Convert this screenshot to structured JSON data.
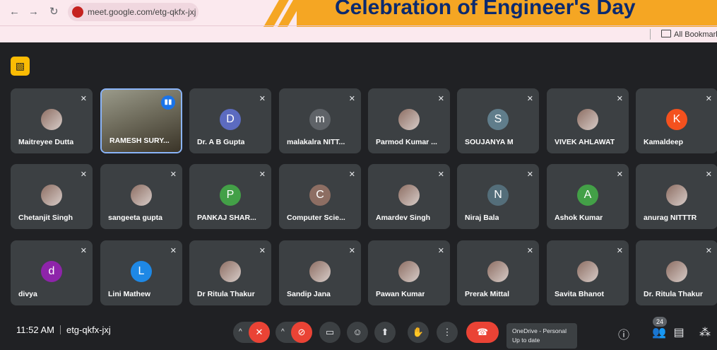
{
  "browser": {
    "back_icon": "arrow-left-icon",
    "forward_icon": "arrow-right-icon",
    "reload_icon": "reload-icon",
    "url": "meet.google.com/etg-qkfx-jxj",
    "banner_title": "Celebration of Engineer's Day",
    "bookmarks_label": "All Bookmarks"
  },
  "meet": {
    "participants": [
      {
        "name": "Maitreyee Dutta",
        "type": "photo"
      },
      {
        "name": "RAMESH SURY...",
        "type": "video",
        "speaking": true
      },
      {
        "name": "Dr. A B Gupta",
        "type": "initial",
        "initial": "D",
        "color": "#5c6bc0"
      },
      {
        "name": "malakalra NITT...",
        "type": "initial",
        "initial": "m",
        "color": "#5f6368"
      },
      {
        "name": "Parmod Kumar ...",
        "type": "photo"
      },
      {
        "name": "SOUJANYA M",
        "type": "initial",
        "initial": "S",
        "color": "#607d8b"
      },
      {
        "name": "VIVEK AHLAWAT",
        "type": "photo"
      },
      {
        "name": "Kamaldeep",
        "type": "initial",
        "initial": "K",
        "color": "#f4511e"
      },
      {
        "name": "Chetanjit Singh",
        "type": "photo"
      },
      {
        "name": "sangeeta gupta",
        "type": "photo"
      },
      {
        "name": "PANKAJ SHAR...",
        "type": "initial",
        "initial": "P",
        "color": "#43a047"
      },
      {
        "name": "Computer Scie...",
        "type": "initial",
        "initial": "C",
        "color": "#8d6e63"
      },
      {
        "name": "Amardev Singh",
        "type": "photo"
      },
      {
        "name": "Niraj Bala",
        "type": "initial",
        "initial": "N",
        "color": "#546e7a"
      },
      {
        "name": "Ashok Kumar",
        "type": "initial",
        "initial": "A",
        "color": "#43a047"
      },
      {
        "name": "anurag NITTTR",
        "type": "photo"
      },
      {
        "name": "divya",
        "type": "initial",
        "initial": "d",
        "color": "#8e24aa"
      },
      {
        "name": "Lini Mathew",
        "type": "initial",
        "initial": "L",
        "color": "#1e88e5"
      },
      {
        "name": "Dr Ritula Thakur",
        "type": "photo"
      },
      {
        "name": "Sandip Jana",
        "type": "photo"
      },
      {
        "name": "Pawan Kumar",
        "type": "photo"
      },
      {
        "name": "Prerak Mittal",
        "type": "photo"
      },
      {
        "name": "Savita Bhanot",
        "type": "photo"
      },
      {
        "name": "Dr. Ritula Thakur",
        "type": "photo"
      }
    ],
    "muted_icon": "mic-off-icon",
    "speaking_icon": "audio-wave-icon"
  },
  "bottom_bar": {
    "time": "11:52 AM",
    "meeting_code": "etg-qkfx-jxj",
    "people_count": "24",
    "toast_title": "OneDrive - Personal",
    "toast_subtitle": "Up to date",
    "colors": {
      "danger": "#ea4335",
      "control": "#3c4043"
    }
  }
}
